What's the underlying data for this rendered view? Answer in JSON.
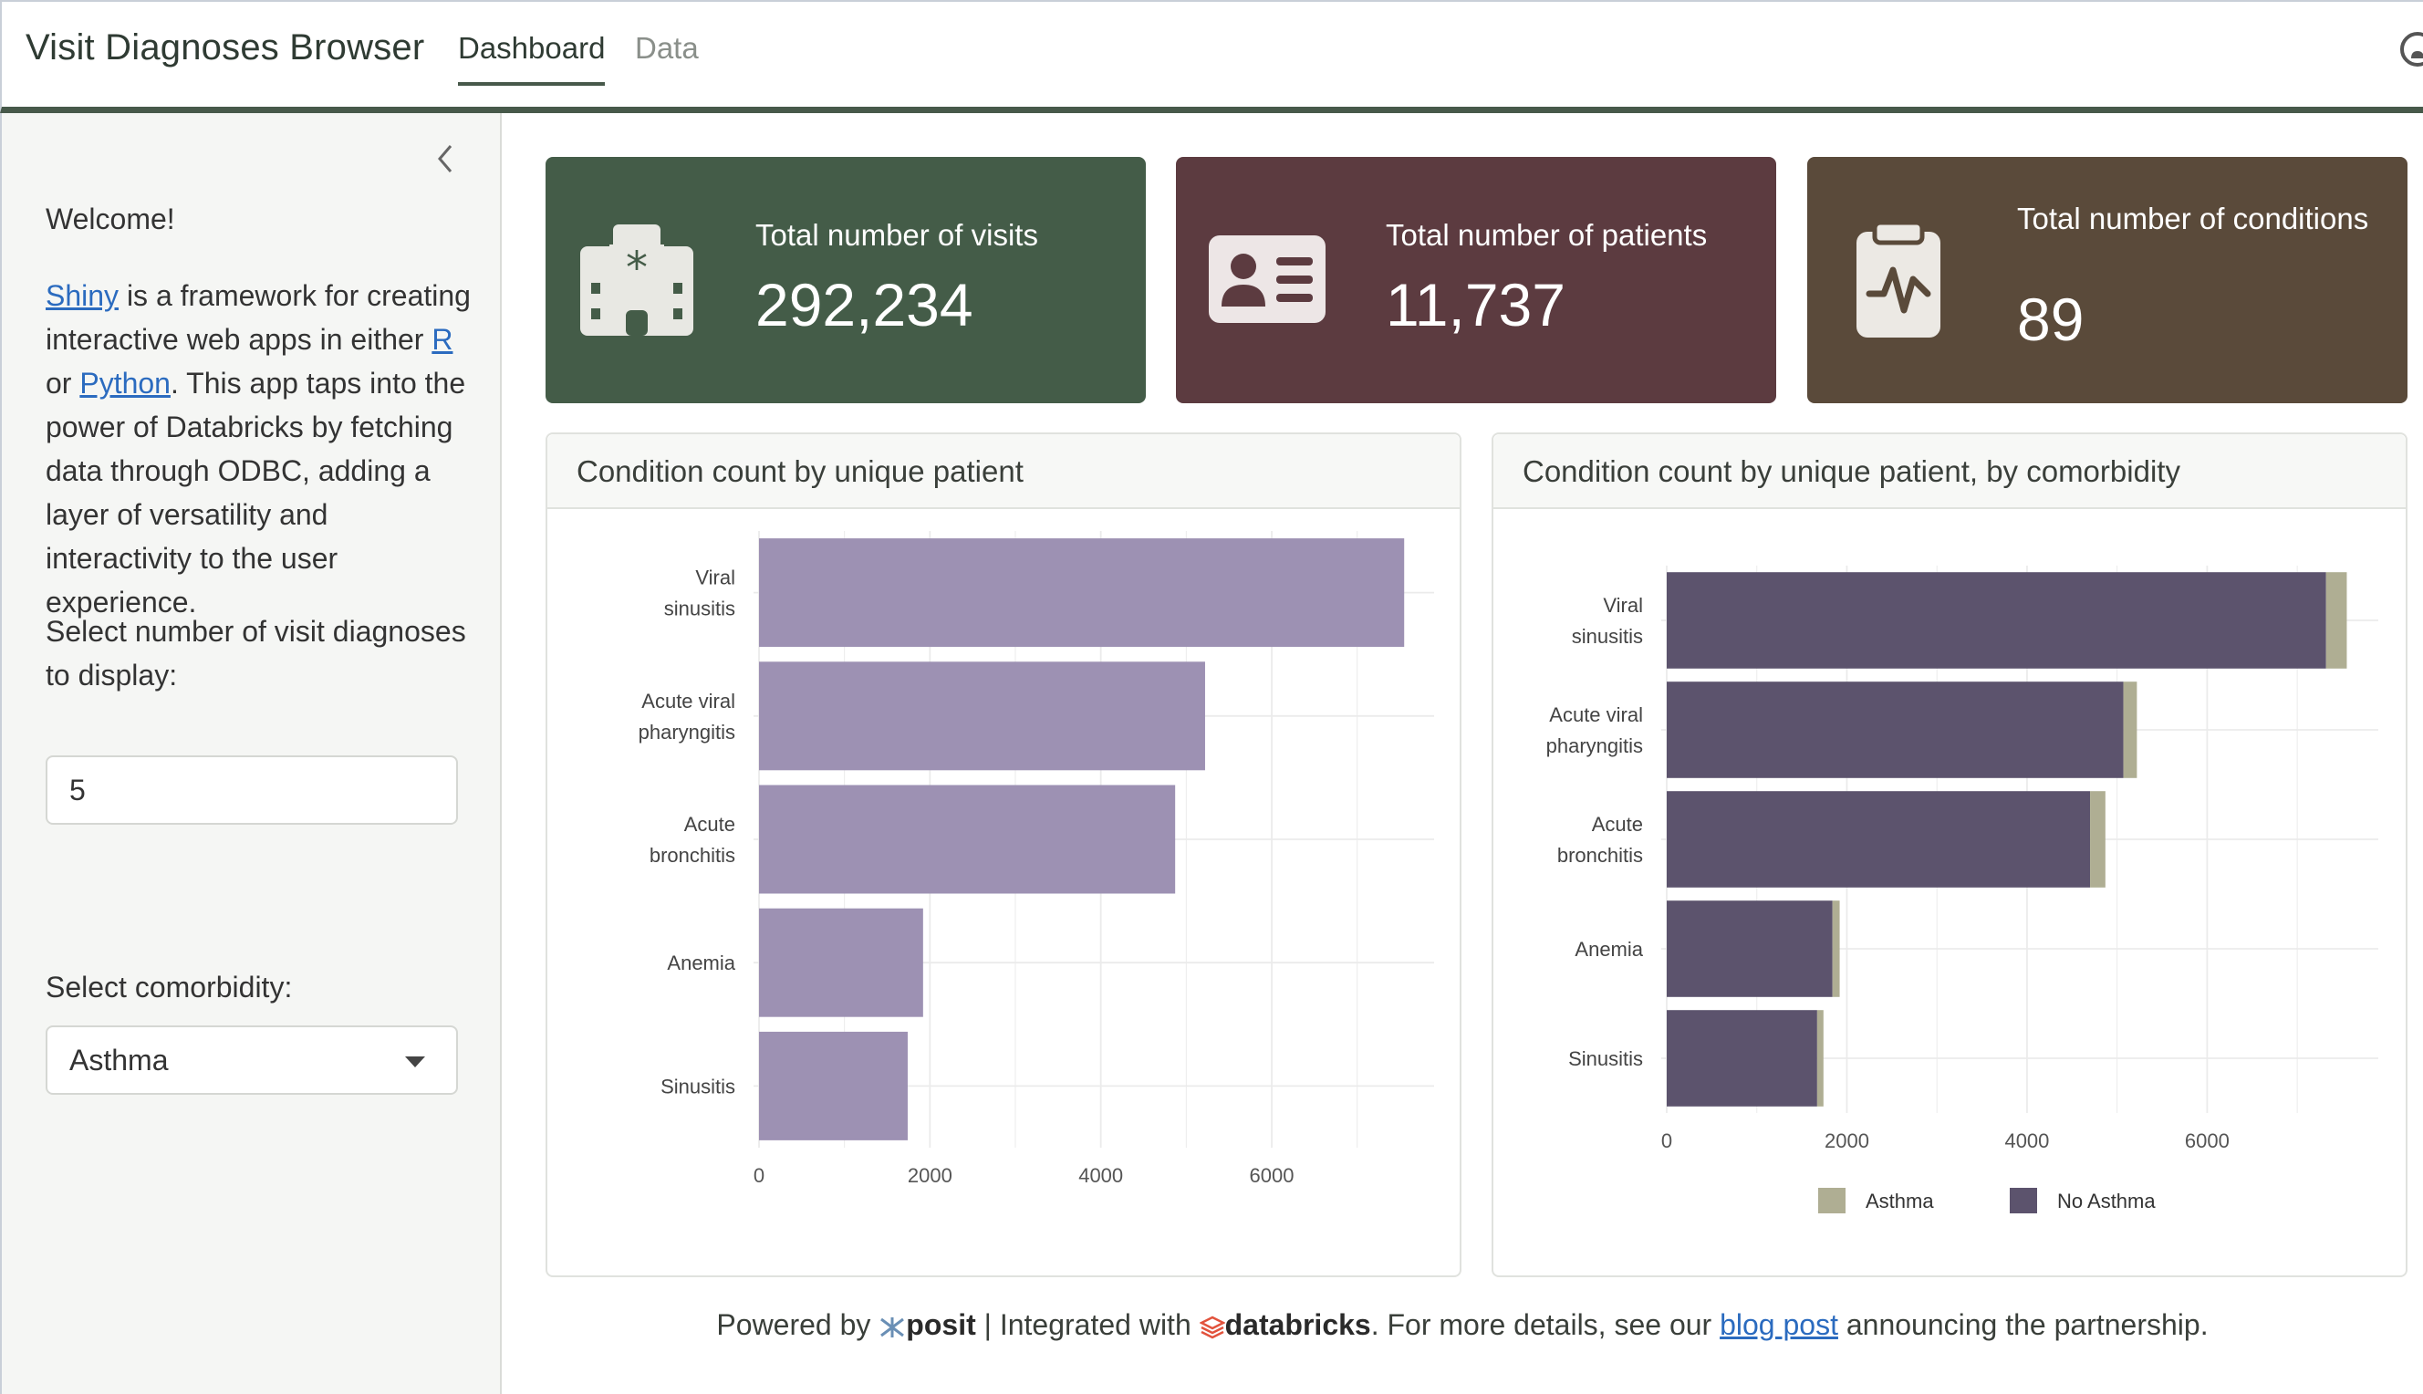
{
  "navbar": {
    "title": "Visit Diagnoses Browser",
    "tabs": [
      {
        "label": "Dashboard",
        "active": true
      },
      {
        "label": "Data",
        "active": false
      }
    ]
  },
  "sidebar": {
    "welcome": "Welcome!",
    "intro": {
      "link_shiny": "Shiny",
      "t1": " is a framework for creating interactive web apps in either ",
      "link_r": "R",
      "t2": " or ",
      "link_python": "Python",
      "t3": ". This app taps into the power of Databricks by fetching data through ODBC, adding a layer of versatility and interactivity to the user experience."
    },
    "num_label": "Select number of visit diagnoses to display:",
    "num_value": "5",
    "comorbidity_label": "Select comorbidity:",
    "comorbidity_value": "Asthma"
  },
  "value_boxes": [
    {
      "title": "Total number of visits",
      "value": "292,234",
      "color": "#445c48",
      "icon": "hospital-icon"
    },
    {
      "title": "Total number of patients",
      "value": "11,737",
      "color": "#5c3b40",
      "icon": "id-card-icon"
    },
    {
      "title": "Total number of conditions",
      "value": "89",
      "color": "#5a4a3a",
      "icon": "clipboard-pulse-icon"
    }
  ],
  "cards": {
    "chart1_title": "Condition count by unique patient",
    "chart2_title": "Condition count by unique patient, by comorbidity"
  },
  "chart_data": [
    {
      "type": "bar",
      "orientation": "horizontal",
      "title": "Condition count by unique patient",
      "categories": [
        "Viral sinusitis",
        "Acute viral pharyngitis",
        "Acute bronchitis",
        "Anemia",
        "Sinusitis"
      ],
      "category_lines": [
        [
          "Viral",
          "sinusitis"
        ],
        [
          "Acute viral",
          "pharyngitis"
        ],
        [
          "Acute",
          "bronchitis"
        ],
        [
          "Anemia"
        ],
        [
          "Sinusitis"
        ]
      ],
      "values": [
        7550,
        5220,
        4870,
        1920,
        1740
      ],
      "xlim": [
        0,
        7900
      ],
      "xticks": [
        0,
        2000,
        4000,
        6000
      ],
      "grid": true,
      "colors": {
        "bar": "#9d91b3"
      }
    },
    {
      "type": "bar",
      "orientation": "horizontal",
      "stacked": true,
      "title": "Condition count by unique patient, by comorbidity",
      "categories": [
        "Viral sinusitis",
        "Acute viral pharyngitis",
        "Acute bronchitis",
        "Anemia",
        "Sinusitis"
      ],
      "category_lines": [
        [
          "Viral",
          "sinusitis"
        ],
        [
          "Acute viral",
          "pharyngitis"
        ],
        [
          "Acute",
          "bronchitis"
        ],
        [
          "Anemia"
        ],
        [
          "Sinusitis"
        ]
      ],
      "series": [
        {
          "name": "No Asthma",
          "values": [
            7320,
            5070,
            4700,
            1840,
            1670
          ],
          "color": "#5c536d"
        },
        {
          "name": "Asthma",
          "values": [
            230,
            150,
            170,
            80,
            70
          ],
          "color": "#afae93"
        }
      ],
      "xlim": [
        0,
        7900
      ],
      "xticks": [
        0,
        2000,
        4000,
        6000
      ],
      "legend_position": "bottom",
      "legend_order": [
        "Asthma",
        "No Asthma"
      ],
      "grid": true
    }
  ],
  "footer": {
    "powered_by": "Powered by ",
    "posit": "posit",
    "integrated": " | Integrated with ",
    "databricks": "databricks",
    "more": ". For more details, see our ",
    "link": "blog post",
    "tail": " announcing the partnership."
  }
}
